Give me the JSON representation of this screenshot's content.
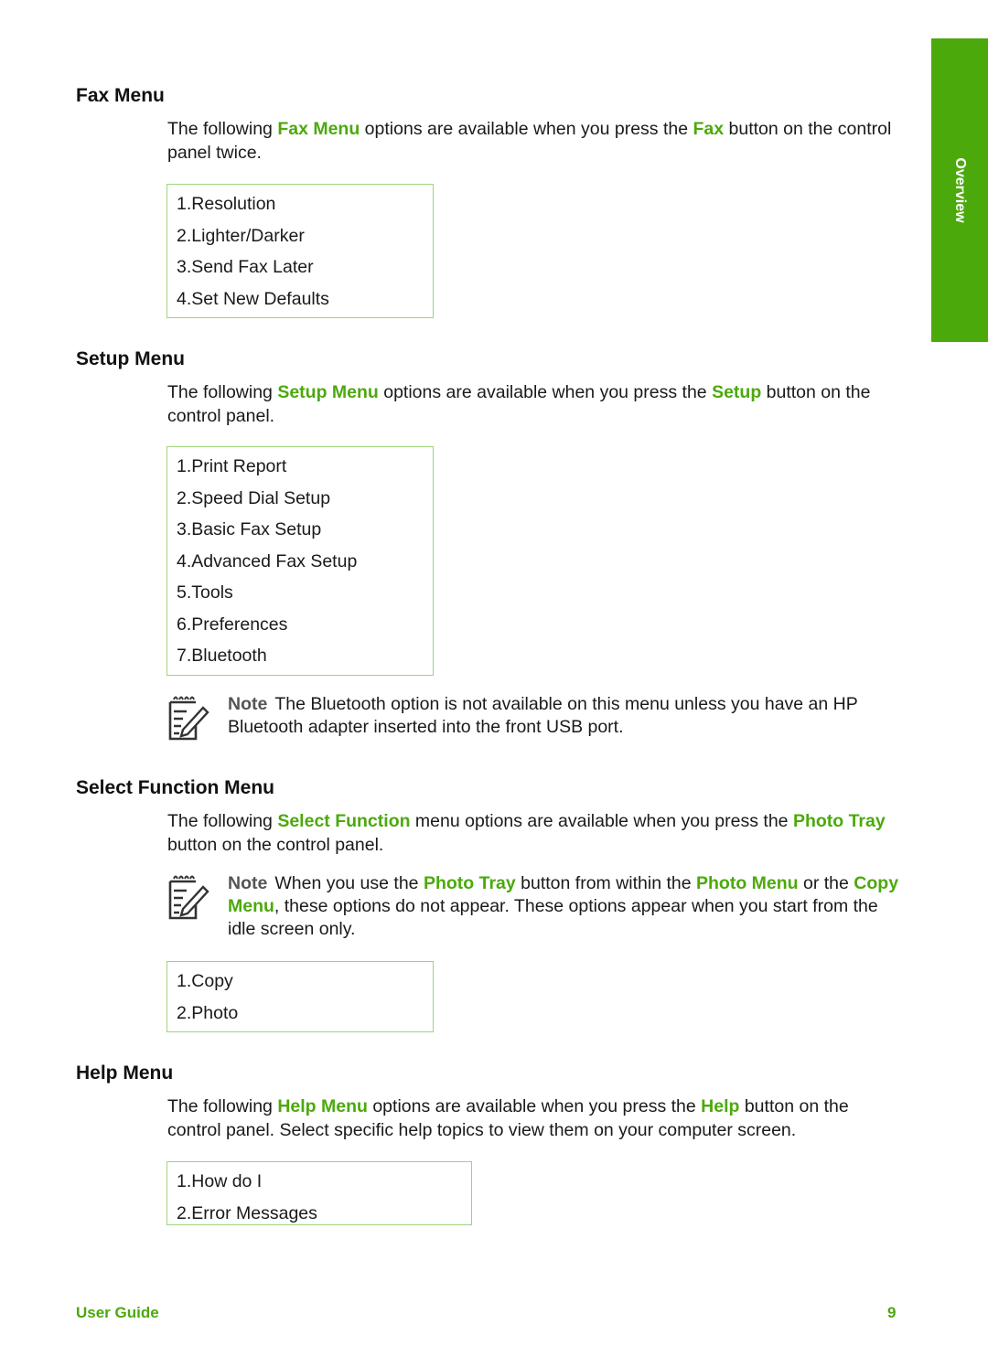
{
  "side_tab": {
    "label": "Overview"
  },
  "accent_color": "#4ca90c",
  "sections": {
    "fax": {
      "title": "Fax Menu",
      "para": {
        "t1": "The following ",
        "h1": "Fax Menu",
        "t2": " options are available when you press the ",
        "h2": "Fax",
        "t3": " button on the control panel twice."
      },
      "items": [
        "1.Resolution",
        "2.Lighter/Darker",
        "3.Send Fax Later",
        "4.Set New Defaults"
      ]
    },
    "setup": {
      "title": "Setup Menu",
      "para": {
        "t1": "The following ",
        "h1": "Setup Menu",
        "t2": " options are available when you press the ",
        "h2": "Setup",
        "t3": " button on the control panel."
      },
      "items": [
        "1.Print Report",
        "2.Speed Dial Setup",
        "3.Basic Fax Setup",
        "4.Advanced Fax Setup",
        "5.Tools",
        "6.Preferences",
        "7.Bluetooth"
      ],
      "note": {
        "label": "Note",
        "text": "The Bluetooth option is not available on this menu unless you have an HP Bluetooth adapter inserted into the front USB port."
      }
    },
    "select_function": {
      "title": "Select Function Menu",
      "para": {
        "t1": "The following ",
        "h1": "Select Function",
        "t2": " menu options are available when you press the ",
        "h2": "Photo Tray",
        "t3": " button on the control panel."
      },
      "note": {
        "label": "Note",
        "t1": "When you use the ",
        "h1": "Photo Tray",
        "t2": " button from within the ",
        "h2": "Photo Menu",
        "t3": " or the ",
        "h3": "Copy Menu",
        "t4": ", these options do not appear. These options appear when you start from the idle screen only."
      },
      "items": [
        "1.Copy",
        "2.Photo"
      ]
    },
    "help": {
      "title": "Help Menu",
      "para": {
        "t1": "The following ",
        "h1": "Help Menu",
        "t2": " options are available when you press the ",
        "h2": "Help",
        "t3": " button on the control panel. Select specific help topics to view them on your computer screen."
      },
      "items": [
        "1.How do I",
        "2.Error Messages"
      ]
    }
  },
  "footer": {
    "left": "User Guide",
    "page_number": "9"
  }
}
